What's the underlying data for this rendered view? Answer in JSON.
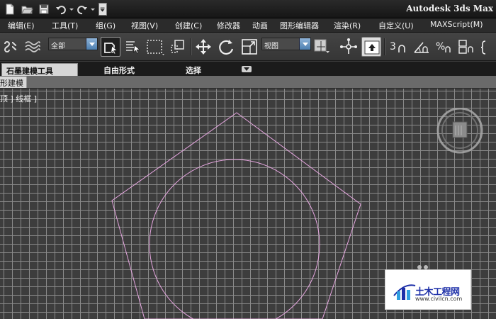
{
  "app": {
    "title": "Autodesk 3ds Max"
  },
  "quick_access": {
    "icons": [
      "new-file-icon",
      "open-folder-icon",
      "save-icon",
      "undo-icon",
      "redo-icon",
      "customize-dropdown-icon"
    ]
  },
  "menu": {
    "items": [
      "编辑(E)",
      "工具(T)",
      "组(G)",
      "视图(V)",
      "创建(C)",
      "修改器",
      "动画",
      "图形编辑器",
      "渲染(R)",
      "自定义(U)",
      "MAXScript(M)"
    ]
  },
  "toolbar": {
    "selection_filter": "全部",
    "reference_coord": "视图",
    "snap_value": "3"
  },
  "ribbon": {
    "tabs": [
      "石墨建模工具",
      "自由形式",
      "选择"
    ],
    "panel_label": "形建模"
  },
  "viewport": {
    "label": "顶 ] 线框 ]",
    "grid_color": "#8a8a8a",
    "shape_color": "#e6a6e0",
    "background": "#3d3d3d"
  },
  "watermark": {
    "name": "土木工程网",
    "url": "www.civilcn.com"
  }
}
